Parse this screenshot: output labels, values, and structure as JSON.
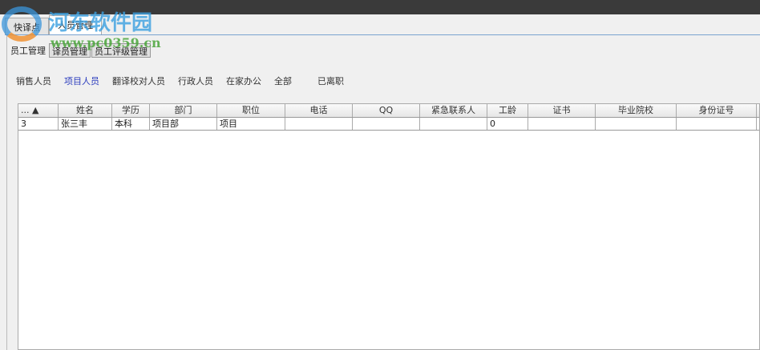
{
  "tabs": [
    {
      "label": "快译点"
    },
    {
      "label": "人员管理"
    }
  ],
  "subtabs": [
    {
      "label": "员工管理"
    },
    {
      "label": "译员管理"
    },
    {
      "label": "员工评级管理"
    }
  ],
  "filters": [
    "销售人员",
    "项目人员",
    "翻译校对人员",
    "行政人员",
    "在家办公",
    "全部",
    "已离职"
  ],
  "table": {
    "columns": [
      "... ▲",
      "姓名",
      "学历",
      "部门",
      "职位",
      "电话",
      "QQ",
      "紧急联系人",
      "工龄",
      "证书",
      "毕业院校",
      "身份证号"
    ],
    "rows": [
      [
        "3",
        "张三丰",
        "本科",
        "项目部",
        "项目",
        "",
        "",
        "",
        "0",
        "",
        "",
        ""
      ]
    ]
  },
  "watermark": {
    "title": "河东软件园",
    "url": "www.pc0359.cn"
  }
}
